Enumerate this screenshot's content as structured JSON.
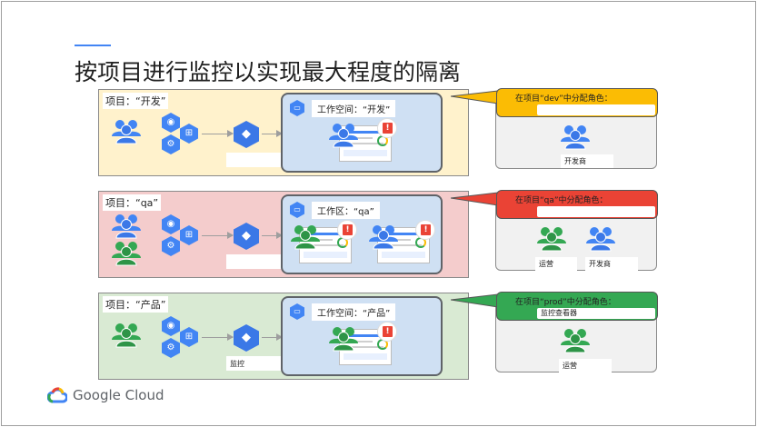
{
  "slide": {
    "title": "按项目进行监控以实现最大程度的隔离",
    "brand": "Google Cloud"
  },
  "colors": {
    "accent": "#4285f4",
    "yellow_band": "#fff2cc",
    "red_band": "#f4cccc",
    "green_band": "#d9ead3",
    "yellow_callout": "#fbbc04",
    "red_callout": "#ea4335",
    "green_callout": "#34a853",
    "blue_people": "#4285f4",
    "green_people": "#34a853"
  },
  "rows": [
    {
      "project_label": "项目：“开发”",
      "workspace_label": "工作空间：“开发”",
      "monitor_label": "",
      "callout_text": "在项目“dev”中分配角色：",
      "callout_sub": "",
      "roles": [
        "开发商"
      ]
    },
    {
      "project_label": "项目：“qa”",
      "workspace_label": "工作区：“qa”",
      "monitor_label": "",
      "callout_text": "在项目“qa”中分配角色：",
      "callout_sub": "",
      "roles": [
        "运营",
        "开发商"
      ]
    },
    {
      "project_label": "项目：“产品”",
      "workspace_label": "工作空间：“产品”",
      "monitor_label": "监控",
      "callout_text": "在项目“prod”中分配角色：",
      "callout_sub": "监控查看器",
      "roles": [
        "运营"
      ]
    }
  ]
}
